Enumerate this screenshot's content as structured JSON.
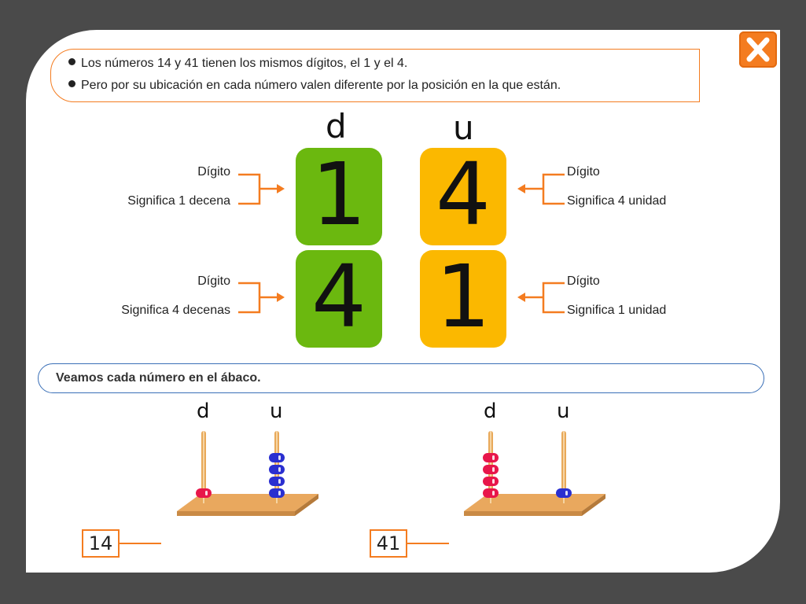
{
  "info": {
    "line1": "Los números 14 y 41 tienen los mismos dígitos, el 1 y el 4.",
    "line2": "Pero por su ubicación en cada número valen diferente por la posición en la que están."
  },
  "places": {
    "tens": "d",
    "units": "u"
  },
  "rows": [
    {
      "tens_digit": "1",
      "units_digit": "4",
      "left_label": "Dígito",
      "left_meaning": "Significa 1 decena",
      "right_label": "Dígito",
      "right_meaning": "Significa 4 unidad"
    },
    {
      "tens_digit": "4",
      "units_digit": "1",
      "left_label": "Dígito",
      "left_meaning": "Significa 4 decenas",
      "right_label": "Dígito",
      "right_meaning": "Significa 1 unidad"
    }
  ],
  "abaco_prompt": "Veamos cada número en el ábaco.",
  "abacuses": [
    {
      "number": "14",
      "tens_beads": 1,
      "units_beads": 4
    },
    {
      "number": "41",
      "tens_beads": 4,
      "units_beads": 1
    }
  ],
  "colors": {
    "accent": "#f47c20",
    "green_tile": "#6bb80f",
    "yellow_tile": "#fbb800",
    "tens_bead": "#e8164a",
    "units_bead": "#2a2fd0",
    "blue_border": "#3a6fb7"
  },
  "icons": {
    "close": "close-x-icon"
  }
}
